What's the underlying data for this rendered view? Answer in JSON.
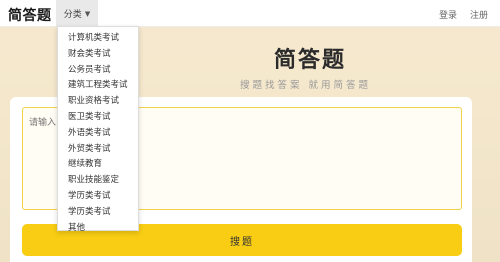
{
  "header": {
    "logo": "简答题",
    "category_label": "分类",
    "login": "登录",
    "register": "注册"
  },
  "hero": {
    "title": "简答题",
    "subtitle": "搜题找答案  就用简答题"
  },
  "search": {
    "placeholder": "请输入",
    "button_label": "搜题"
  },
  "dropdown": {
    "items": [
      "计算机类考试",
      "财会类考试",
      "公务员考试",
      "建筑工程类考试",
      "职业资格考试",
      "医卫类考试",
      "外语类考试",
      "外贸类考试",
      "继续教育",
      "职业技能鉴定",
      "学历类考试",
      "学历类考试",
      "其他"
    ]
  },
  "colors": {
    "accent": "#f8cd13",
    "input_border": "#f2d24a",
    "background": "#f4e7cc"
  }
}
